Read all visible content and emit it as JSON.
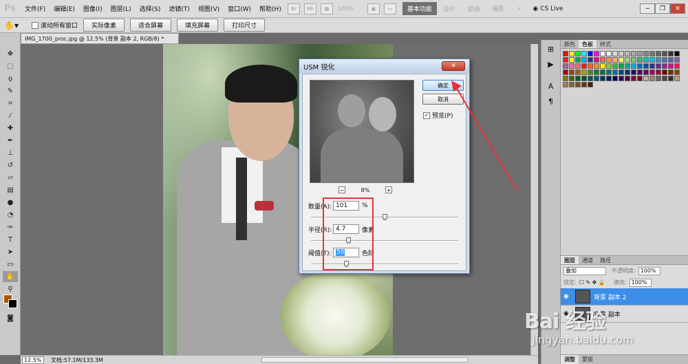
{
  "app": {
    "logo": "Ps"
  },
  "menu": [
    "文件(F)",
    "编辑(E)",
    "图像(I)",
    "图层(L)",
    "选择(S)",
    "滤镜(T)",
    "视图(V)",
    "窗口(W)",
    "帮助(H)"
  ],
  "menubar_icons": {
    "br": "Br",
    "mb": "Mb"
  },
  "zoom_dd": "100%",
  "workspace": {
    "active": "基本功能",
    "others": [
      "设计",
      "绘画",
      "摄影"
    ],
    "more": "»",
    "cslive": "CS Live"
  },
  "options": {
    "scroll_all": "滚动所有窗口",
    "buttons": [
      "实际像素",
      "适合屏幕",
      "填充屏幕",
      "打印尺寸"
    ]
  },
  "doc_tab": "IMG_1700_proc.jpg @ 12.5% (背景 副本 2, RGB/8) *",
  "status": {
    "zoom": "12.5%",
    "docinfo": "文档:57.1M/133.3M"
  },
  "swatch_tabs": [
    "颜色",
    "色板",
    "样式"
  ],
  "swatches": [
    "#ff0000",
    "#ffff00",
    "#00ff00",
    "#00ffff",
    "#0000ff",
    "#ff00ff",
    "#ffffff",
    "#eeeeee",
    "#dddddd",
    "#cccccc",
    "#bbbbbb",
    "#aaaaaa",
    "#999999",
    "#888888",
    "#777777",
    "#666666",
    "#555555",
    "#333333",
    "#000000",
    "#ee1d24",
    "#fff200",
    "#00a650",
    "#00aeef",
    "#2e3192",
    "#ec008c",
    "#f26c4f",
    "#f68e55",
    "#fbaf5c",
    "#fff467",
    "#acd372",
    "#7cc576",
    "#3bb878",
    "#1abbb4",
    "#00bff3",
    "#438ccb",
    "#5574b9",
    "#605ca8",
    "#855fa8",
    "#a763a8",
    "#f06ea9",
    "#f26d7d",
    "#ed1c24",
    "#f26522",
    "#f7941d",
    "#fff200",
    "#8dc63f",
    "#39b54a",
    "#00a651",
    "#00a99d",
    "#00aeef",
    "#0072bc",
    "#0054a6",
    "#2e3192",
    "#662d91",
    "#92278f",
    "#ec008c",
    "#ed145b",
    "#9e0b0f",
    "#a0410d",
    "#a3620a",
    "#aba000",
    "#598527",
    "#1a7b30",
    "#007236",
    "#00746b",
    "#0076a3",
    "#004a80",
    "#003471",
    "#1b1464",
    "#440e62",
    "#630460",
    "#9e005d",
    "#9e0039",
    "#790000",
    "#7b2e00",
    "#7d4900",
    "#827b00",
    "#406618",
    "#005e20",
    "#005826",
    "#005952",
    "#005b7f",
    "#003663",
    "#002157",
    "#0d004c",
    "#32004b",
    "#4b0049",
    "#7b0046",
    "#7a0026",
    "#c7b299",
    "#998675",
    "#736357",
    "#534741",
    "#37302a",
    "#c69c6d",
    "#a67c52",
    "#8c6239",
    "#754c24",
    "#603913",
    "#42210b"
  ],
  "layers_panel": {
    "tabs": [
      "图层",
      "通道",
      "路径"
    ],
    "blend_mode": "叠加",
    "opacity_label": "不透明度:",
    "opacity": "100%",
    "lock_label": "锁定:",
    "fill_label": "填充:",
    "fill": "100%",
    "layers": [
      {
        "name": "背景 副本 2",
        "selected": true
      },
      {
        "name": "背景 副本",
        "selected": false
      }
    ],
    "bottom_tabs": [
      "调整",
      "蒙版"
    ]
  },
  "dialog": {
    "title": "USM 锐化",
    "close": "✕",
    "ok": "确定",
    "cancel": "取消",
    "preview_label": "预览(P)",
    "zoom_minus": "−",
    "zoom_plus": "+",
    "zoom_value": "8%",
    "amount_label": "数量(A):",
    "amount": "101",
    "amount_unit": "%",
    "amount_level": 0.5,
    "radius_label": "半径(R):",
    "radius": "4.7",
    "radius_unit": "像素",
    "radius_level": 0.25,
    "threshold_label": "阈值(T):",
    "threshold": "50",
    "threshold_unit": "色阶",
    "threshold_level": 0.24
  },
  "watermark": {
    "brand": "Bai 经验",
    "url": "jingyan.baidu.com"
  },
  "colors": {
    "accent": "#3d8ee8",
    "annotation": "#e8313a",
    "foreground": "#a05a07",
    "background": "#000000"
  }
}
